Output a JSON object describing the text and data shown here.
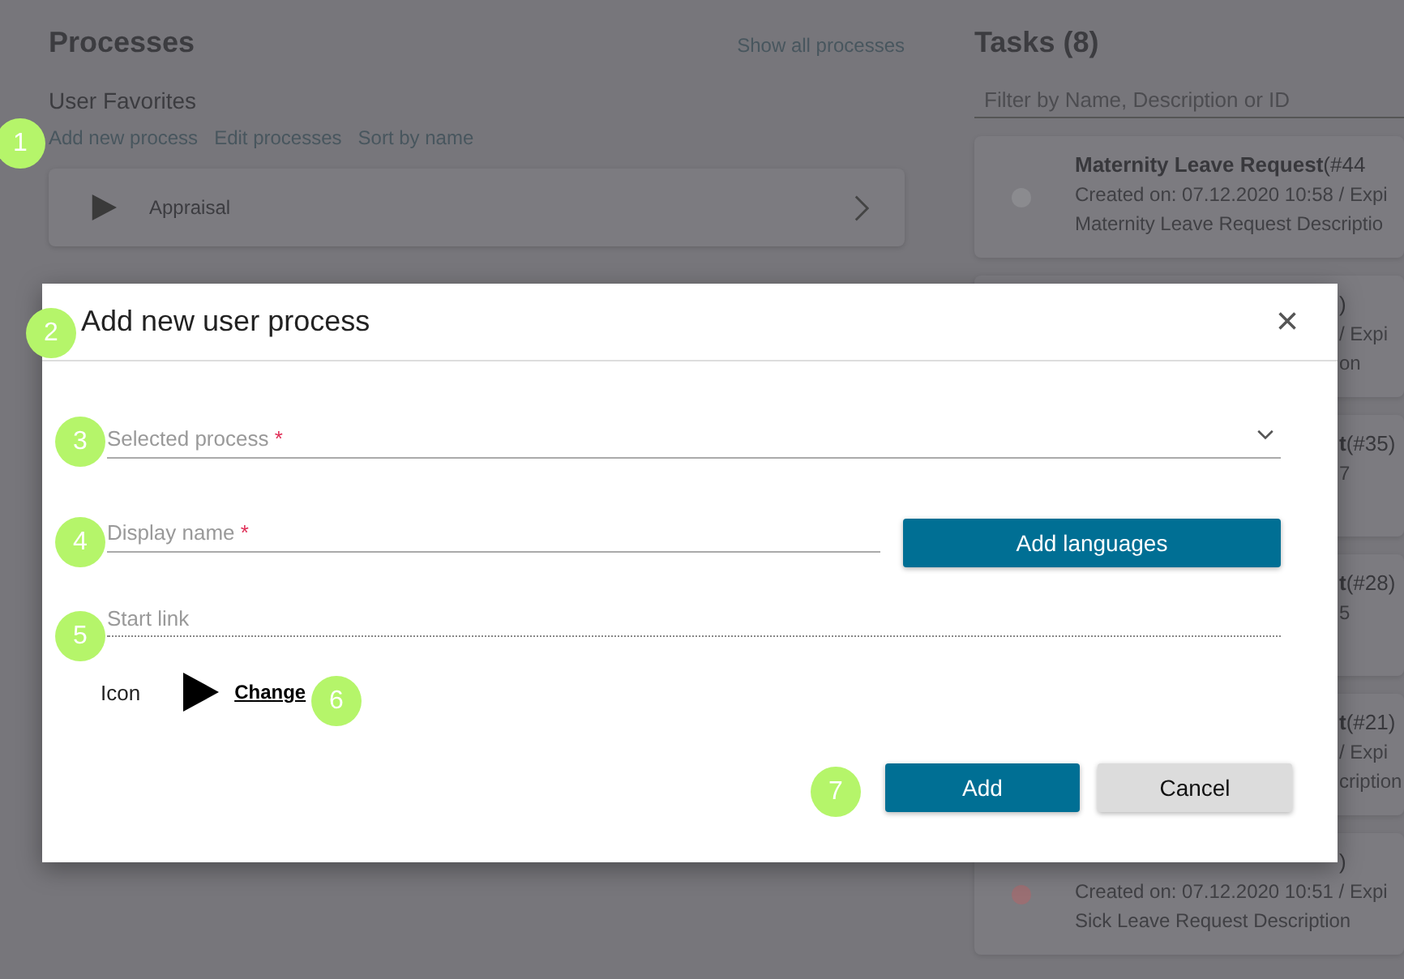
{
  "processes": {
    "title": "Processes",
    "show_all": "Show all processes",
    "favorites_heading": "User Favorites",
    "actions": [
      "Add new process",
      "Edit processes",
      "Sort by name"
    ],
    "favorites": [
      {
        "name": "Appraisal"
      }
    ]
  },
  "tasks": {
    "title": "Tasks (8)",
    "filter": {
      "placeholder": "Filter by Name, Description or ID"
    },
    "items": [
      {
        "color": "#8b8b8f",
        "title": "Maternity Leave Request",
        "number": "(#44",
        "created": "Created on: 07.12.2020 10:58 / Expi",
        "description": "Maternity Leave Request Descriptio",
        "title_cut": false,
        "body_cut": false
      },
      {
        "number": ")",
        "created": "/ Expi",
        "description": "on",
        "title_cut": true,
        "body_cut": true
      },
      {
        "title": "t",
        "number": "(#35)",
        "created": "7",
        "title_cut": true,
        "body_cut": true
      },
      {
        "title": "t",
        "number": "(#28)",
        "created": "5",
        "title_cut": true,
        "body_cut": true
      },
      {
        "title": "t",
        "number": "(#21)",
        "created": "/ Expi",
        "description": "cription",
        "title_cut": true,
        "body_cut": true
      },
      {
        "color": "#9a6f73",
        "number": ")",
        "created": "Created on: 07.12.2020 10:51 / Expi",
        "description": "Sick Leave Request Description",
        "title_cut": true,
        "body_cut": false
      }
    ]
  },
  "dialog": {
    "title": "Add new user process",
    "close": "×",
    "selected_process": {
      "label": "Selected process",
      "required_mark": "*"
    },
    "display_name": {
      "label": "Display name",
      "required_mark": "*"
    },
    "add_languages": "Add languages",
    "start_link": {
      "placeholder": "Start link"
    },
    "icon_label": "Icon",
    "change": "Change",
    "buttons": [
      {
        "label": "Add",
        "kind": "primary"
      },
      {
        "label": "Cancel",
        "kind": "secondary"
      }
    ]
  },
  "annotations": [
    "1",
    "2",
    "3",
    "4",
    "5",
    "6",
    "7"
  ]
}
